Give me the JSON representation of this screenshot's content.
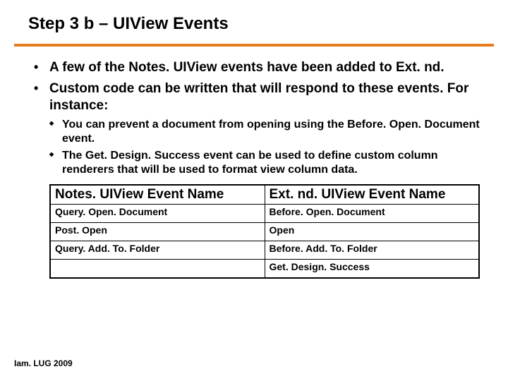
{
  "title": "Step 3 b – UIView Events",
  "bullets": {
    "b1": "A few of the Notes. UIView events have been added to Ext. nd.",
    "b2": "Custom code can be written that will respond to these events.  For instance:",
    "sub1": "You can prevent a document from opening using the Before. Open. Document event.",
    "sub2": "The Get. Design. Success event can be used to define custom column renderers that will be used to format view column data."
  },
  "table": {
    "h1": "Notes. UIView Event Name",
    "h2": "Ext. nd. UIView Event Name",
    "r1c1": "Query. Open. Document",
    "r1c2": "Before. Open. Document",
    "r2c1": "Post. Open",
    "r2c2": "Open",
    "r3c1": "Query. Add. To. Folder",
    "r3c2": "Before. Add. To. Folder",
    "r4c1": "",
    "r4c2": "Get. Design. Success"
  },
  "footer": "Iam. LUG 2009"
}
